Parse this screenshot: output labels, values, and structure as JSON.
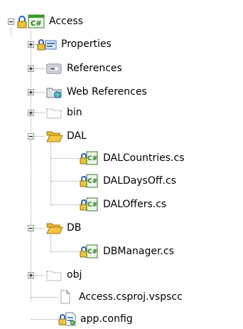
{
  "solution_tree": {
    "project": {
      "label": "Access",
      "icon": "csharp-project-icon",
      "expanded": true,
      "checked_in": true
    },
    "items": [
      {
        "label": "Properties",
        "icon": "properties-folder-icon",
        "expanded": false
      },
      {
        "label": "References",
        "icon": "references-icon",
        "expanded": false
      },
      {
        "label": "Web References",
        "icon": "web-references-icon",
        "expanded": false
      },
      {
        "label": "bin",
        "icon": "dashed-folder-icon",
        "expanded": false
      },
      {
        "label": "DAL",
        "icon": "open-folder-icon",
        "expanded": true,
        "children": [
          {
            "label": "DALCountries.cs",
            "icon": "csharp-file-icon"
          },
          {
            "label": "DALDaysOff.cs",
            "icon": "csharp-file-icon"
          },
          {
            "label": "DALOffers.cs",
            "icon": "csharp-file-icon"
          }
        ]
      },
      {
        "label": "DB",
        "icon": "open-folder-icon",
        "expanded": true,
        "children": [
          {
            "label": "DBManager.cs",
            "icon": "csharp-file-icon"
          }
        ]
      },
      {
        "label": "obj",
        "icon": "dashed-folder-icon",
        "expanded": false
      },
      {
        "label": "Access.csproj.vspscc",
        "icon": "file-icon"
      },
      {
        "label": "app.config",
        "icon": "config-file-icon"
      }
    ]
  },
  "colors": {
    "csharp_green": "#3a9a2f",
    "folder_yellow": "#f5c542",
    "lock_blue": "#2f5fb3",
    "connector_gray": "#a0a0a0"
  }
}
